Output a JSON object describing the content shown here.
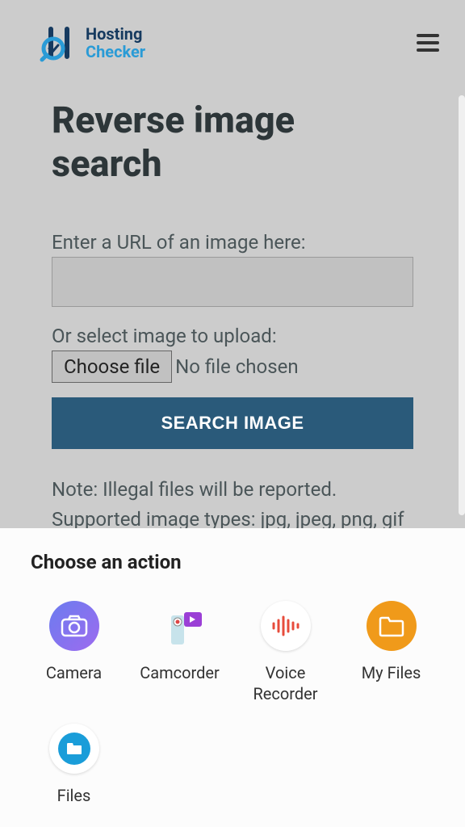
{
  "header": {
    "logo_top": "Hosting",
    "logo_bottom": "Checker"
  },
  "page": {
    "title": "Reverse image search",
    "url_label": "Enter a URL of an image here:",
    "upload_label": "Or select image to upload:",
    "choose_file_label": "Choose file",
    "file_status": "No file chosen",
    "search_button": "SEARCH IMAGE",
    "note_line1": "Note: Illegal files will be reported.",
    "note_line2": "Supported image types: jpg, jpeg, png, gif"
  },
  "sheet": {
    "title": "Choose an action",
    "actions": [
      {
        "label": "Camera"
      },
      {
        "label": "Camcorder"
      },
      {
        "label": "Voice\nRecorder"
      },
      {
        "label": "My Files"
      },
      {
        "label": "Files"
      }
    ]
  }
}
